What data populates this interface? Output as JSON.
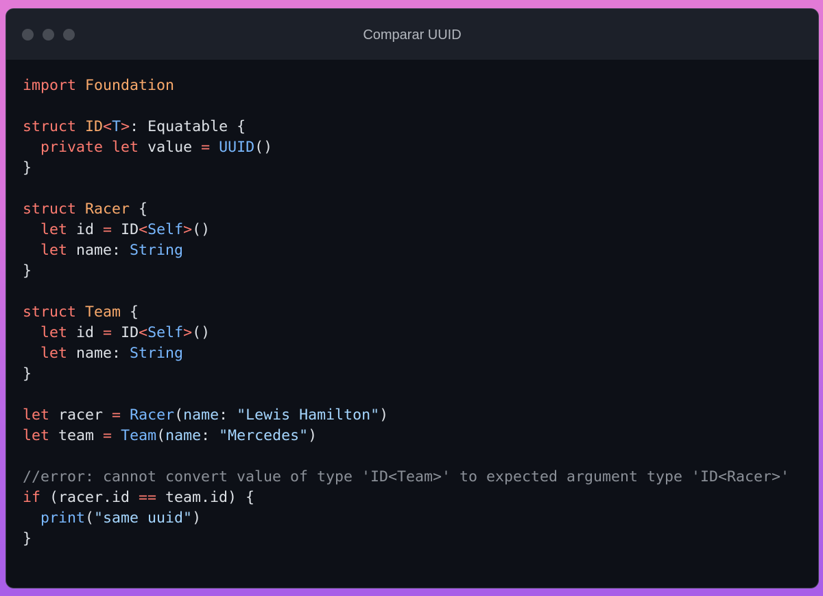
{
  "window": {
    "title": "Comparar UUID"
  },
  "code": {
    "lines": [
      [
        {
          "t": "import",
          "c": "kw"
        },
        {
          "t": " ",
          "c": "pl"
        },
        {
          "t": "Foundation",
          "c": "ty"
        }
      ],
      [],
      [
        {
          "t": "struct",
          "c": "kw"
        },
        {
          "t": " ",
          "c": "pl"
        },
        {
          "t": "ID",
          "c": "ty"
        },
        {
          "t": "<",
          "c": "kw"
        },
        {
          "t": "T",
          "c": "bl"
        },
        {
          "t": ">",
          "c": "kw"
        },
        {
          "t": ": Equatable {",
          "c": "pl"
        }
      ],
      [
        {
          "t": "  ",
          "c": "pl"
        },
        {
          "t": "private",
          "c": "kw"
        },
        {
          "t": " ",
          "c": "pl"
        },
        {
          "t": "let",
          "c": "kw"
        },
        {
          "t": " value ",
          "c": "pl"
        },
        {
          "t": "=",
          "c": "kw"
        },
        {
          "t": " ",
          "c": "pl"
        },
        {
          "t": "UUID",
          "c": "bl"
        },
        {
          "t": "()",
          "c": "pl"
        }
      ],
      [
        {
          "t": "}",
          "c": "pl"
        }
      ],
      [],
      [
        {
          "t": "struct",
          "c": "kw"
        },
        {
          "t": " ",
          "c": "pl"
        },
        {
          "t": "Racer",
          "c": "ty"
        },
        {
          "t": " {",
          "c": "pl"
        }
      ],
      [
        {
          "t": "  ",
          "c": "pl"
        },
        {
          "t": "let",
          "c": "kw"
        },
        {
          "t": " id ",
          "c": "pl"
        },
        {
          "t": "=",
          "c": "kw"
        },
        {
          "t": " ID",
          "c": "pl"
        },
        {
          "t": "<",
          "c": "kw"
        },
        {
          "t": "Self",
          "c": "bl"
        },
        {
          "t": ">",
          "c": "kw"
        },
        {
          "t": "()",
          "c": "pl"
        }
      ],
      [
        {
          "t": "  ",
          "c": "pl"
        },
        {
          "t": "let",
          "c": "kw"
        },
        {
          "t": " name: ",
          "c": "pl"
        },
        {
          "t": "String",
          "c": "bl"
        }
      ],
      [
        {
          "t": "}",
          "c": "pl"
        }
      ],
      [],
      [
        {
          "t": "struct",
          "c": "kw"
        },
        {
          "t": " ",
          "c": "pl"
        },
        {
          "t": "Team",
          "c": "ty"
        },
        {
          "t": " {",
          "c": "pl"
        }
      ],
      [
        {
          "t": "  ",
          "c": "pl"
        },
        {
          "t": "let",
          "c": "kw"
        },
        {
          "t": " id ",
          "c": "pl"
        },
        {
          "t": "=",
          "c": "kw"
        },
        {
          "t": " ID",
          "c": "pl"
        },
        {
          "t": "<",
          "c": "kw"
        },
        {
          "t": "Self",
          "c": "bl"
        },
        {
          "t": ">",
          "c": "kw"
        },
        {
          "t": "()",
          "c": "pl"
        }
      ],
      [
        {
          "t": "  ",
          "c": "pl"
        },
        {
          "t": "let",
          "c": "kw"
        },
        {
          "t": " name: ",
          "c": "pl"
        },
        {
          "t": "String",
          "c": "bl"
        }
      ],
      [
        {
          "t": "}",
          "c": "pl"
        }
      ],
      [],
      [
        {
          "t": "let",
          "c": "kw"
        },
        {
          "t": " racer ",
          "c": "pl"
        },
        {
          "t": "=",
          "c": "kw"
        },
        {
          "t": " ",
          "c": "pl"
        },
        {
          "t": "Racer",
          "c": "bl"
        },
        {
          "t": "(",
          "c": "pl"
        },
        {
          "t": "name",
          "c": "st"
        },
        {
          "t": ": ",
          "c": "pl"
        },
        {
          "t": "\"Lewis Hamilton\"",
          "c": "st"
        },
        {
          "t": ")",
          "c": "pl"
        }
      ],
      [
        {
          "t": "let",
          "c": "kw"
        },
        {
          "t": " team ",
          "c": "pl"
        },
        {
          "t": "=",
          "c": "kw"
        },
        {
          "t": " ",
          "c": "pl"
        },
        {
          "t": "Team",
          "c": "bl"
        },
        {
          "t": "(",
          "c": "pl"
        },
        {
          "t": "name",
          "c": "st"
        },
        {
          "t": ": ",
          "c": "pl"
        },
        {
          "t": "\"Mercedes\"",
          "c": "st"
        },
        {
          "t": ")",
          "c": "pl"
        }
      ],
      [],
      [
        {
          "t": "//error: cannot convert value of type 'ID<Team>' to expected argument type 'ID<Racer>'",
          "c": "cm"
        }
      ],
      [
        {
          "t": "if",
          "c": "kw"
        },
        {
          "t": " (racer.id ",
          "c": "pl"
        },
        {
          "t": "==",
          "c": "kw"
        },
        {
          "t": " team.id) {",
          "c": "pl"
        }
      ],
      [
        {
          "t": "  ",
          "c": "pl"
        },
        {
          "t": "print",
          "c": "bl"
        },
        {
          "t": "(",
          "c": "pl"
        },
        {
          "t": "\"same uuid\"",
          "c": "st"
        },
        {
          "t": ")",
          "c": "pl"
        }
      ],
      [
        {
          "t": "}",
          "c": "pl"
        }
      ]
    ]
  },
  "colors": {
    "keyword": "#fe7b70",
    "type_name": "#f9a96b",
    "builtin": "#79b8ff",
    "string": "#a5d6ff",
    "comment": "#8b9098",
    "plain": "#dde1e6",
    "editor_bg": "#0d1017",
    "titlebar_bg": "#1c2029"
  }
}
